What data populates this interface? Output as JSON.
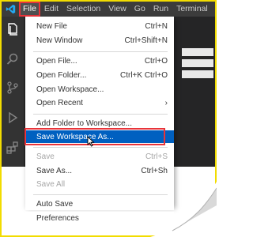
{
  "menubar": {
    "items": [
      "File",
      "Edit",
      "Selection",
      "View",
      "Go",
      "Run",
      "Terminal"
    ]
  },
  "file_menu": {
    "items": [
      {
        "label": "New File",
        "shortcut": "Ctrl+N"
      },
      {
        "label": "New Window",
        "shortcut": "Ctrl+Shift+N"
      },
      {
        "label": "Open File...",
        "shortcut": "Ctrl+O"
      },
      {
        "label": "Open Folder...",
        "shortcut": "Ctrl+K Ctrl+O"
      },
      {
        "label": "Open Workspace...",
        "shortcut": ""
      },
      {
        "label": "Open Recent",
        "shortcut": "›"
      },
      {
        "label": "Add Folder to Workspace...",
        "shortcut": ""
      },
      {
        "label": "Save Workspace As...",
        "shortcut": ""
      },
      {
        "label": "Save",
        "shortcut": "Ctrl+S"
      },
      {
        "label": "Save As...",
        "shortcut": "Ctrl+Sh"
      },
      {
        "label": "Save All",
        "shortcut": ""
      },
      {
        "label": "Auto Save",
        "shortcut": ""
      },
      {
        "label": "Preferences",
        "shortcut": ""
      }
    ]
  },
  "colors": {
    "highlight": "#0060c0",
    "annotation_red": "#e8343a",
    "frame_yellow": "#f2dc00",
    "vscode_blue": "#23a9f2"
  },
  "icons": [
    "vscode-logo-icon",
    "explorer-icon",
    "search-icon",
    "source-control-icon",
    "run-debug-icon",
    "extensions-icon",
    "mouse-cursor-icon"
  ]
}
